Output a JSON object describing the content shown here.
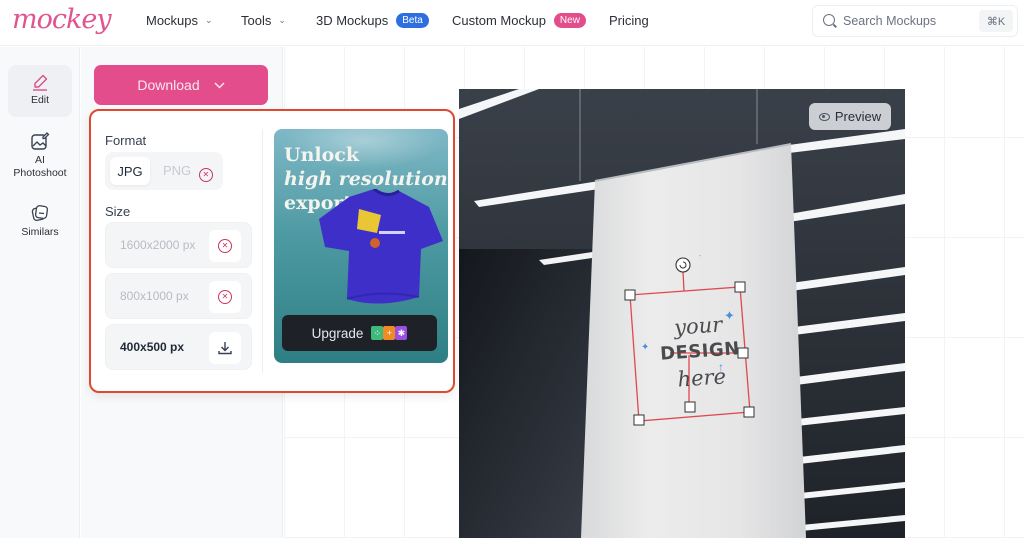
{
  "brand": {
    "logo_text": "mockey",
    "accent": "#e34d8c"
  },
  "nav": {
    "items": [
      {
        "label": "Mockups",
        "has_dropdown": true
      },
      {
        "label": "Tools",
        "has_dropdown": true
      },
      {
        "label": "3D Mockups",
        "badge": "Beta",
        "badge_color": "#2d6fe0"
      },
      {
        "label": "Custom Mockup",
        "badge": "New",
        "badge_color": "#e34d8c"
      },
      {
        "label": "Pricing"
      }
    ],
    "search": {
      "placeholder": "Search Mockups",
      "shortcut": "⌘K"
    }
  },
  "sidebar": {
    "items": [
      {
        "label": "Edit",
        "icon": "pencil-icon",
        "active": true
      },
      {
        "label": "AI Photoshoot",
        "icon": "ai-photo-icon",
        "active": false
      },
      {
        "label": "Similars",
        "icon": "stack-icon",
        "active": false
      }
    ]
  },
  "download": {
    "button_label": "Download",
    "format_label": "Format",
    "formats": [
      {
        "label": "JPG",
        "selected": true,
        "locked": false
      },
      {
        "label": "PNG",
        "selected": false,
        "locked": true
      }
    ],
    "size_label": "Size",
    "sizes": [
      {
        "label": "1600x2000 px",
        "locked": true
      },
      {
        "label": "800x1000 px",
        "locked": true
      },
      {
        "label": "400x500 px",
        "locked": false
      }
    ],
    "promo": {
      "line1": "Unlock",
      "line2": "high resolution",
      "line3": "export",
      "button_label": "Upgrade",
      "chip_colors": [
        "#3fba7a",
        "#f08a24",
        "#9b4fe0"
      ]
    }
  },
  "canvas": {
    "preview_label": "Preview",
    "design_text": {
      "line1": "your",
      "line2": "DESIGN",
      "line3": "here"
    },
    "selection_color": "#e0484f"
  }
}
